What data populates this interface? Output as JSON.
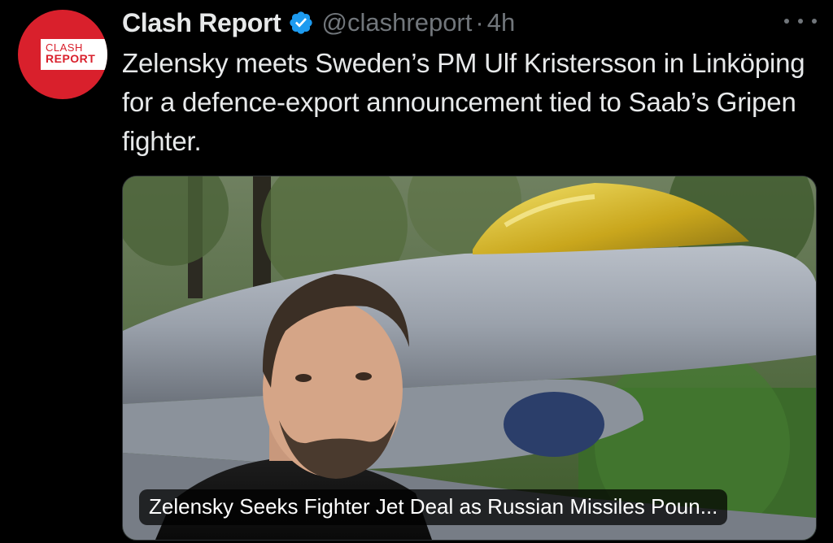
{
  "author": {
    "display_name": "Clash Report",
    "handle": "@clashreport",
    "separator": "·",
    "time": "4h",
    "verified_icon": "verified-badge-icon",
    "avatar_logo": {
      "line1": "CLASH",
      "line2": "REPORT"
    }
  },
  "tweet": {
    "text": "Zelensky meets Sweden’s PM Ulf Kristersson in Linköping for a defence-export announcement tied to Saab’s Gripen fighter."
  },
  "media": {
    "caption": "Zelensky Seeks Fighter Jet Deal as Russian Missiles Poun..."
  },
  "icons": {
    "more": "more-options-icon"
  },
  "colors": {
    "background": "#000000",
    "text_primary": "#e7e9ea",
    "text_secondary": "#71767b",
    "verified_blue": "#1d9bf0",
    "avatar_red": "#d9202c"
  }
}
